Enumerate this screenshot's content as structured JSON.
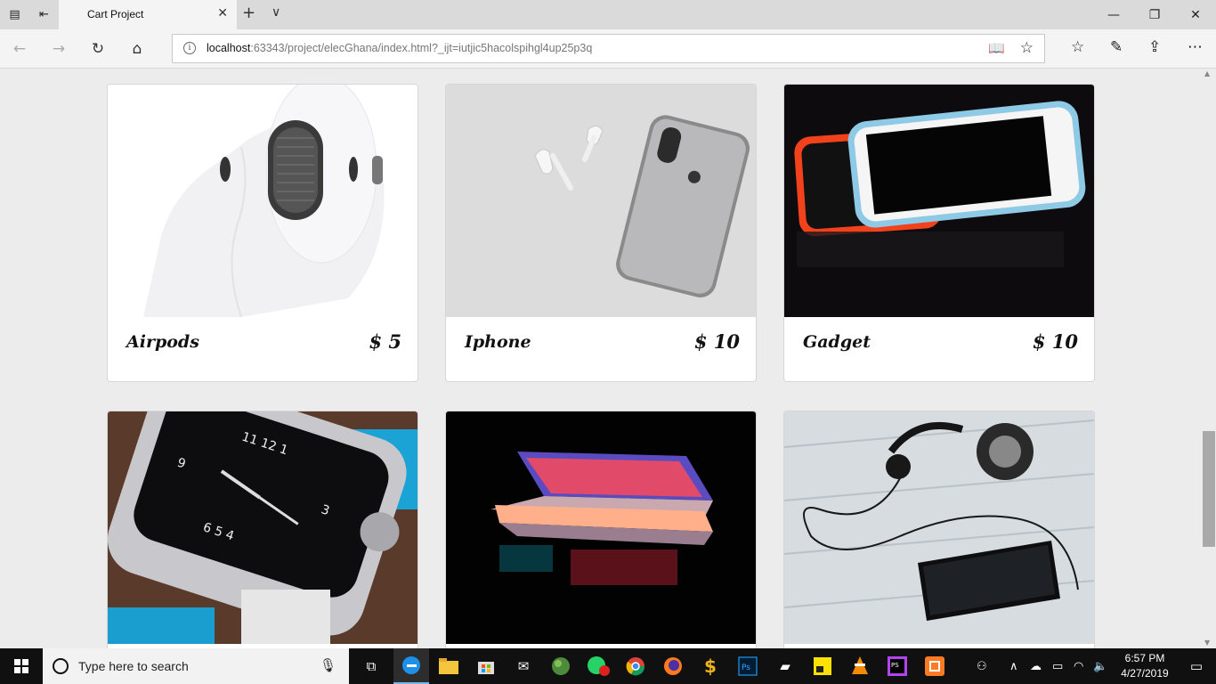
{
  "browser": {
    "tab_title": "Cart Project",
    "url_host": "localhost",
    "url_rest": ":63343/project/elecGhana/index.html?_ijt=iutjic5hacolspihgl4up25p3q"
  },
  "products": [
    {
      "name": "Airpods",
      "price": "$ 5"
    },
    {
      "name": "Iphone",
      "price": "$ 10"
    },
    {
      "name": "Gadget",
      "price": "$ 10"
    },
    {
      "name": "",
      "price": ""
    },
    {
      "name": "",
      "price": ""
    },
    {
      "name": "",
      "price": ""
    }
  ],
  "taskbar": {
    "search_placeholder": "Type here to search",
    "time": "6:57 PM",
    "date": "4/27/2019",
    "whatsapp_badge": "99"
  },
  "colors": {
    "page_bg": "#ececec",
    "taskbar_bg": "#101010",
    "edge_blue": "#1e90e8"
  }
}
